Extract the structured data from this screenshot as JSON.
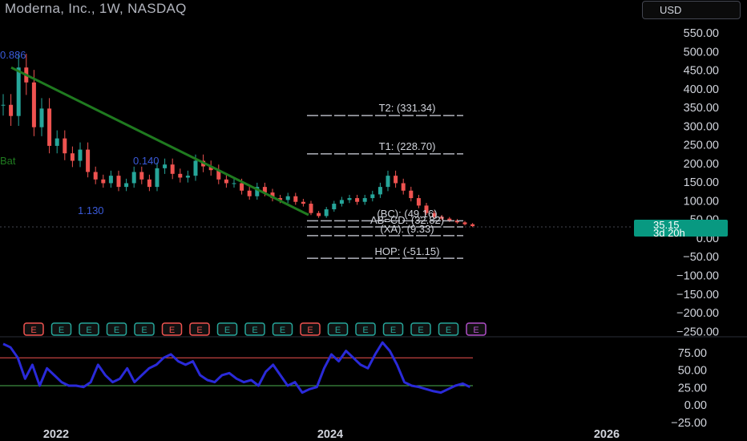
{
  "header": {
    "title": "Moderna, Inc., 1W, NASDAQ",
    "currency": "USD"
  },
  "price_badge": {
    "price": "35.15",
    "countdown": "3d 20h"
  },
  "colors": {
    "background": "#000000",
    "axis_text": "#d1d4dc",
    "trendline": "#1f7a1f",
    "up_candle": "#26a69a",
    "down_candle": "#ef5350",
    "oscillator": "#2a2ad9",
    "earnings_green": "#26a69a",
    "earnings_red": "#ef5350"
  },
  "price_axis": {
    "ticks": [
      "550.00",
      "500.00",
      "450.00",
      "400.00",
      "350.00",
      "300.00",
      "250.00",
      "200.00",
      "150.00",
      "100.00",
      "50.00",
      "0.00",
      "−50.00",
      "−100.00",
      "−150.00",
      "−200.00",
      "−250.00"
    ]
  },
  "osc_axis": {
    "ticks": [
      "75.00",
      "50.00",
      "25.00",
      "0.00",
      "−25.00"
    ]
  },
  "time_axis": {
    "labels": [
      "2022",
      "2024",
      "2026"
    ]
  },
  "harmonic": {
    "t2": "T2: (331.34)",
    "t1": "T1: (228.70)",
    "bc": "(BC): (49.16)",
    "abcd": "AB=CD: (32.82)",
    "xa": "(XA): (9.33)",
    "hop": "HOP: (-51.15)",
    "pattern": "Bat",
    "ratio_a": "0.886",
    "ratio_b": "0.140",
    "ratio_c": "1.130"
  },
  "earnings": {
    "markers": [
      {
        "label": "E",
        "color": "red"
      },
      {
        "label": "E",
        "color": "green"
      },
      {
        "label": "E",
        "color": "green"
      },
      {
        "label": "E",
        "color": "green"
      },
      {
        "label": "E",
        "color": "green"
      },
      {
        "label": "E",
        "color": "red"
      },
      {
        "label": "E",
        "color": "red"
      },
      {
        "label": "E",
        "color": "green"
      },
      {
        "label": "E",
        "color": "green"
      },
      {
        "label": "E",
        "color": "green"
      },
      {
        "label": "E",
        "color": "red"
      },
      {
        "label": "E",
        "color": "green"
      },
      {
        "label": "E",
        "color": "green"
      },
      {
        "label": "E",
        "color": "green"
      },
      {
        "label": "E",
        "color": "green"
      },
      {
        "label": "E",
        "color": "green"
      },
      {
        "label": "E",
        "color": "pending"
      }
    ]
  },
  "chart_data": {
    "type": "candlestick",
    "symbol": "Moderna, Inc., 1W, NASDAQ",
    "ylim": [
      -250,
      560
    ],
    "price_series_close": [
      360,
      330,
      460,
      420,
      300,
      350,
      250,
      270,
      230,
      210,
      240,
      180,
      160,
      150,
      170,
      140,
      150,
      180,
      160,
      140,
      190,
      200,
      175,
      165,
      170,
      210,
      195,
      185,
      160,
      150,
      150,
      130,
      115,
      140,
      125,
      110,
      105,
      115,
      100,
      95,
      70,
      62,
      80,
      95,
      105,
      110,
      100,
      110,
      120,
      140,
      170,
      150,
      130,
      110,
      90,
      70,
      60,
      55,
      50,
      45,
      40,
      35
    ],
    "trendline": {
      "from": 460,
      "to": 65
    },
    "oscillator": {
      "ylim": [
        -25,
        100
      ],
      "levels": [
        70,
        30
      ],
      "values": [
        90,
        85,
        70,
        40,
        60,
        30,
        55,
        45,
        35,
        30,
        30,
        28,
        35,
        60,
        45,
        35,
        40,
        55,
        35,
        45,
        55,
        60,
        70,
        75,
        65,
        60,
        65,
        45,
        38,
        35,
        45,
        48,
        40,
        35,
        38,
        30,
        50,
        60,
        45,
        30,
        35,
        20,
        25,
        28,
        55,
        75,
        65,
        80,
        70,
        60,
        55,
        75,
        92,
        80,
        60,
        35,
        30,
        28,
        25,
        22,
        20,
        25,
        30,
        33,
        28
      ]
    }
  }
}
